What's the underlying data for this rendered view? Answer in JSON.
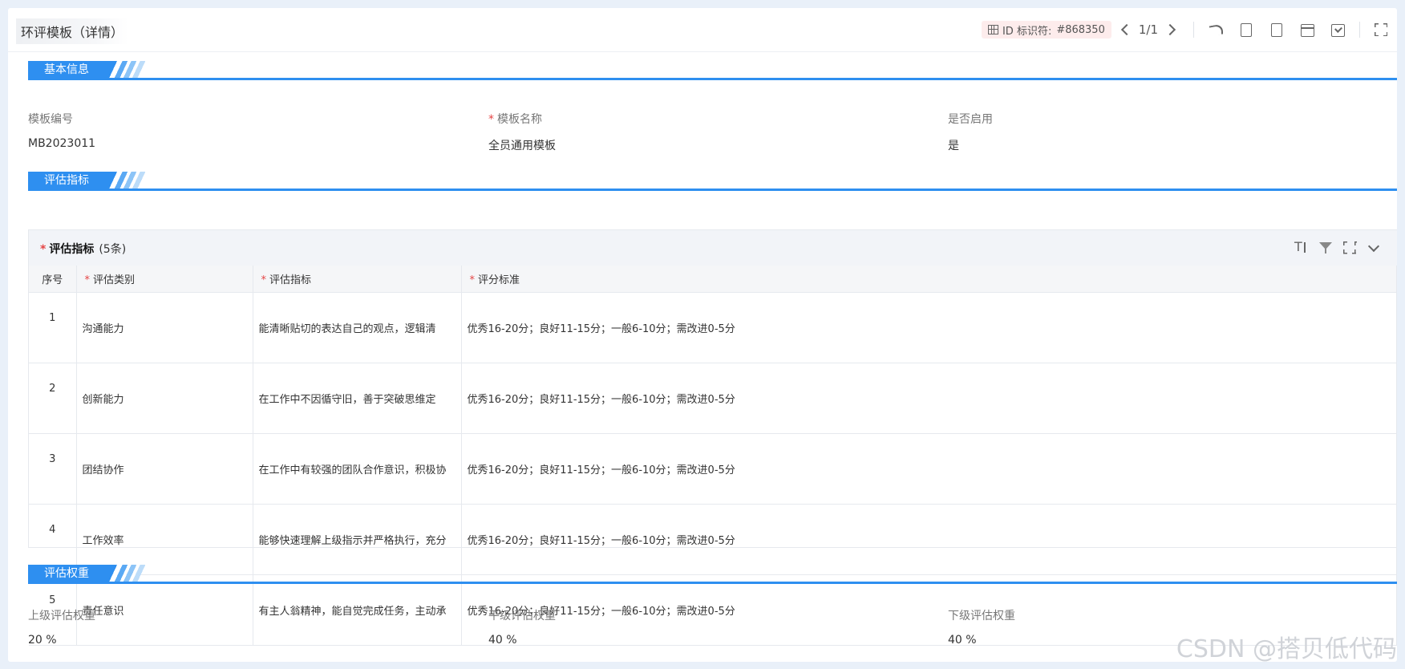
{
  "header": {
    "title": "环评模板（详情）",
    "id_label": "ID 标识符:",
    "id_value": "#868350",
    "pager": "1/1"
  },
  "sections": {
    "basic": "基本信息",
    "indicators": "评估指标",
    "weights": "评估权重"
  },
  "basic": {
    "code_label": "模板编号",
    "code_value": "MB2023011",
    "name_label": "模板名称",
    "name_value": "全员通用模板",
    "enabled_label": "是否启用",
    "enabled_value": "是"
  },
  "indicator_table": {
    "title": "评估指标",
    "count": "(5条)",
    "columns": [
      "序号",
      "评估类别",
      "评估指标",
      "评分标准"
    ],
    "rows": [
      {
        "no": "1",
        "category": "沟通能力",
        "indicator": "能清晰贴切的表达自己的观点，逻辑清",
        "standard": "优秀16-20分；良好11-15分；一般6-10分；需改进0-5分"
      },
      {
        "no": "2",
        "category": "创新能力",
        "indicator": "在工作中不因循守旧，善于突破思维定",
        "standard": "优秀16-20分；良好11-15分；一般6-10分；需改进0-5分"
      },
      {
        "no": "3",
        "category": "团结协作",
        "indicator": "在工作中有较强的团队合作意识，积极协",
        "standard": "优秀16-20分；良好11-15分；一般6-10分；需改进0-5分"
      },
      {
        "no": "4",
        "category": "工作效率",
        "indicator": "能够快速理解上级指示并严格执行，充分",
        "standard": "优秀16-20分；良好11-15分；一般6-10分；需改进0-5分"
      },
      {
        "no": "5",
        "category": "责任意识",
        "indicator": "有主人翁精神，能自觉完成任务，主动承",
        "standard": "优秀16-20分；良好11-15分；一般6-10分；需改进0-5分"
      }
    ]
  },
  "weights": {
    "upper_label": "上级评估权重",
    "upper_value": "20 %",
    "peer_label": "平级评估权重",
    "peer_value": "40 %",
    "lower_label": "下级评估权重",
    "lower_value": "40 %"
  },
  "watermark": "CSDN @搭贝低代码"
}
